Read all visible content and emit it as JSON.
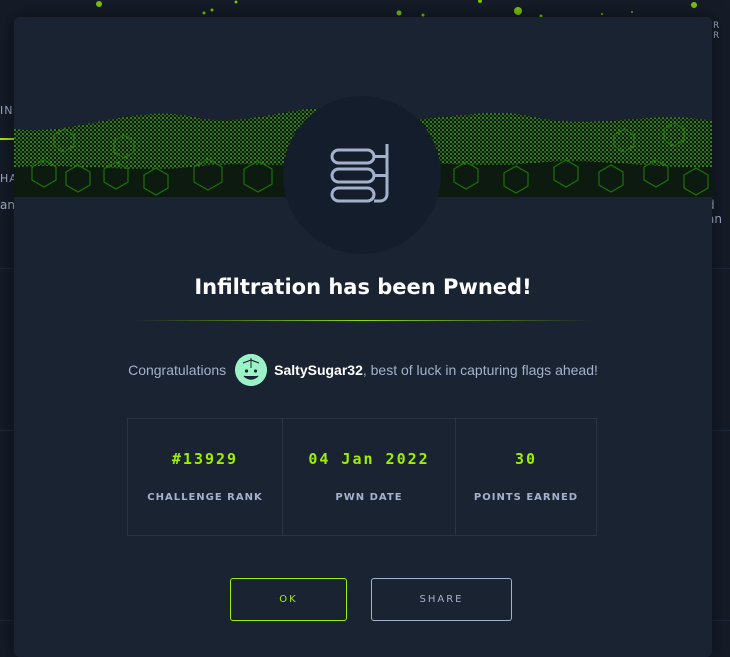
{
  "colors": {
    "accent": "#9fef00",
    "modal_bg": "#1a2332",
    "page_bg": "#151c28",
    "text_muted": "#a4b1cd",
    "text_white": "#ffffff"
  },
  "background": {
    "partial_texts": [
      "IN",
      "HA",
      "an",
      "d an",
      "R R"
    ]
  },
  "modal": {
    "emblem_icon": "database-stack-icon",
    "title": "Infiltration has been Pwned!",
    "congrats_prefix": "Congratulations",
    "username": "SaltySugar32",
    "congrats_suffix": ", best of luck in capturing flags ahead!",
    "stats": [
      {
        "value": "#13929",
        "label": "CHALLENGE RANK"
      },
      {
        "value": "04 Jan 2022",
        "label": "PWN DATE"
      },
      {
        "value": "30",
        "label": "POINTS EARNED"
      }
    ],
    "ok_label": "OK",
    "share_label": "SHARE"
  }
}
